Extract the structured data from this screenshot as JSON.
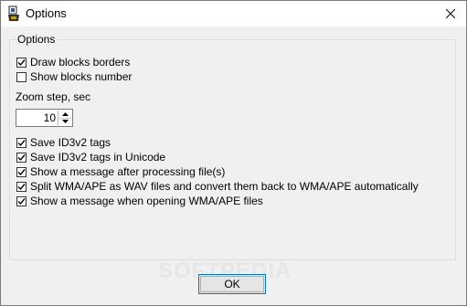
{
  "window": {
    "title": "Options"
  },
  "group": {
    "title": "Options"
  },
  "top_checkboxes": [
    {
      "label": "Draw blocks borders",
      "checked": true
    },
    {
      "label": "Show blocks number",
      "checked": false
    }
  ],
  "zoom": {
    "label": "Zoom step, sec",
    "value": "10"
  },
  "bottom_checkboxes": [
    {
      "label": "Save ID3v2 tags",
      "checked": true
    },
    {
      "label": "Save ID3v2 tags in Unicode",
      "checked": true
    },
    {
      "label": "Show a message after processing file(s)",
      "checked": true
    },
    {
      "label": "Split WMA/APE as WAV files and convert them back to WMA/APE automatically",
      "checked": true
    },
    {
      "label": "Show a message when opening WMA/APE files",
      "checked": true
    }
  ],
  "buttons": {
    "ok": "OK"
  },
  "watermark": "SOFTPEDIA"
}
